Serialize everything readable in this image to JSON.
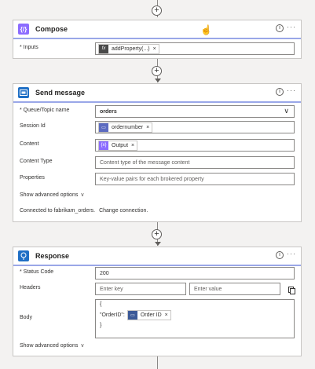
{
  "compose": {
    "title": "Compose",
    "inputs_label": "* Inputs",
    "token": "addProperty(...)",
    "token_icon": "fx",
    "header_color": "#8c6cff"
  },
  "send": {
    "title": "Send message",
    "queue_label": "* Queue/Topic name",
    "queue_value": "orders",
    "session_label": "Session Id",
    "session_token": "ordernumber",
    "content_label": "Content",
    "content_token": "Output",
    "content_token_icon": "{x}",
    "content_type_label": "Content Type",
    "content_type_placeholder": "Content type of the message content",
    "properties_label": "Properties",
    "properties_placeholder": "Key-value pairs for each brokered property",
    "advanced": "Show advanced options",
    "connected_text": "Connected to fabrikam_orders.",
    "change_link": "Change connection.",
    "header_color": "#1f6fc5"
  },
  "response": {
    "title": "Response",
    "status_label": "* Status Code",
    "status_value": "200",
    "headers_label": "Headers",
    "key_placeholder": "Enter key",
    "value_placeholder": "Enter value",
    "body_label": "Body",
    "body_open": "{",
    "body_key": "\"OrderID\":",
    "body_token": "Order ID",
    "body_close": "}",
    "advanced": "Show advanced options",
    "header_color": "#1f6fc5"
  },
  "common": {
    "info_glyph": "i",
    "more_glyph": "···",
    "close_glyph": "×",
    "plus_glyph": "+",
    "chevron_down": "∨"
  },
  "colors": {
    "compose_accent": "#8c6cff",
    "servicebus_accent": "#0078d4",
    "token_servicebus": "#5c6bc0",
    "token_request": "#3b5998"
  }
}
